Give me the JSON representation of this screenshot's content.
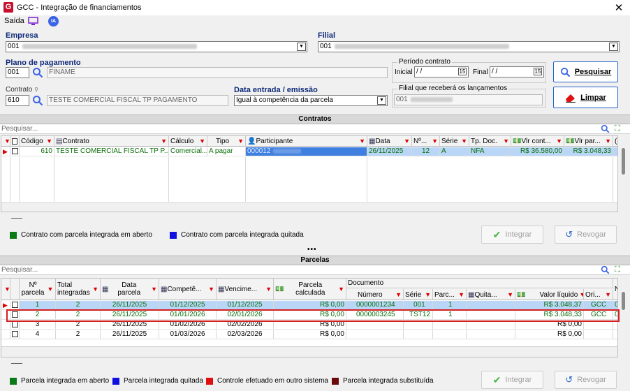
{
  "window": {
    "title": "GCC - Integração de financiamentos",
    "logo": "G",
    "close": "✕"
  },
  "menu": {
    "saida": "Saída",
    "ia": "IA"
  },
  "empresa": {
    "label": "Empresa",
    "code": "001"
  },
  "filial": {
    "label": "Filial",
    "code": "001"
  },
  "plano": {
    "label": "Plano de pagamento",
    "code": "001",
    "desc": "FINAME"
  },
  "contrato": {
    "label": "Contrato",
    "code": "610",
    "desc": "TESTE COMERCIAL FISCAL TP PAGAMENTO"
  },
  "data_entrada": {
    "label": "Data entrada / emissão",
    "value": "Igual à competência da parcela"
  },
  "periodo": {
    "label": "Período contrato",
    "inicial_label": "Inicial",
    "inicial_value": " /  /",
    "final_label": "Final",
    "final_value": " /  /",
    "cal": "15"
  },
  "filial_lanc": {
    "label": "Filial que receberá os lançamentos",
    "code": "001"
  },
  "buttons": {
    "pesquisar": "Pesquisar",
    "limpar": "Limpar",
    "integrar": "Integrar",
    "revogar": "Revogar"
  },
  "contratos": {
    "title": "Contratos",
    "search_placeholder": "Pesquisar...",
    "headers": [
      "Código",
      "Contrato",
      "Cálculo",
      "Tipo",
      "Participante",
      "Data",
      "Nº...",
      "Série",
      "Tp. Doc.",
      "Vlr cont...",
      "Vlr par..."
    ],
    "rows": [
      {
        "codigo": "610",
        "contrato": "TESTE COMERCIAL FISCAL TP P...",
        "calculo": "Comercial...",
        "tipo": "A pagar",
        "participante": "000012",
        "data": "26/11/2025",
        "num": "12",
        "serie": "A",
        "tpdoc": "NFA",
        "vlrcont": "R$ 36.580,00",
        "vlrpar": "R$ 3.048,33"
      }
    ],
    "legend": [
      {
        "color": "#0a7a16",
        "label": "Contrato com parcela integrada em aberto"
      },
      {
        "color": "#1010e0",
        "label": "Contrato com parcela integrada quitada"
      }
    ]
  },
  "splitter": "•••",
  "parcelas": {
    "title": "Parcelas",
    "search_placeholder": "Pesquisar...",
    "headers": {
      "num1": "Nº",
      "num2": "parcela",
      "tot1": "Total",
      "tot2": "integradas",
      "data1": "Data",
      "data2": "parcela",
      "comp": "Competê...",
      "venc": "Vencime...",
      "parc1": "Parcela",
      "parc2": "calculada",
      "documento": "Documento",
      "numero": "Número",
      "serie": "Série",
      "parc": "Parc...",
      "quita": "Quita...",
      "valor": "Valor líquido",
      "ori": "Ori..."
    },
    "rows": [
      {
        "num": "1",
        "total": "2",
        "data": "26/11/2025",
        "comp": "01/12/2025",
        "venc": "01/12/2025",
        "calc": "R$ 0,00",
        "numero": "0000001234",
        "serie": "001",
        "parc": "1",
        "quita": "",
        "valor": "R$ 3.048,37",
        "ori": "GCC",
        "extra": "0"
      },
      {
        "num": "2",
        "total": "2",
        "data": "26/11/2025",
        "comp": "01/01/2026",
        "venc": "02/01/2026",
        "calc": "R$ 0,00",
        "numero": "0000003245",
        "serie": "TST12",
        "parc": "1",
        "quita": "",
        "valor": "R$ 3.048,33",
        "ori": "GCC",
        "extra": "0"
      },
      {
        "num": "3",
        "total": "2",
        "data": "26/11/2025",
        "comp": "01/02/2026",
        "venc": "02/02/2026",
        "calc": "R$ 0,00",
        "numero": "",
        "serie": "",
        "parc": "",
        "quita": "",
        "valor": "R$ 0,00",
        "ori": "",
        "extra": ""
      },
      {
        "num": "4",
        "total": "2",
        "data": "26/11/2025",
        "comp": "01/03/2026",
        "venc": "02/03/2026",
        "calc": "R$ 0,00",
        "numero": "",
        "serie": "",
        "parc": "",
        "quita": "",
        "valor": "R$ 0,00",
        "ori": "",
        "extra": ""
      }
    ],
    "legend": [
      {
        "color": "#0a7a16",
        "label": "Parcela integrada em aberto"
      },
      {
        "color": "#1010e0",
        "label": "Parcela integrada quitada"
      },
      {
        "color": "#e01010",
        "label": "Controle efetuado em outro sistema"
      },
      {
        "color": "#6b0a0a",
        "label": "Parcela integrada substituída"
      }
    ]
  },
  "colors": {
    "accent": "#2563c9",
    "highlight_box": "#d42020",
    "row_selected": "#b9d6f7",
    "row_green_text": "#0a6e0a"
  }
}
